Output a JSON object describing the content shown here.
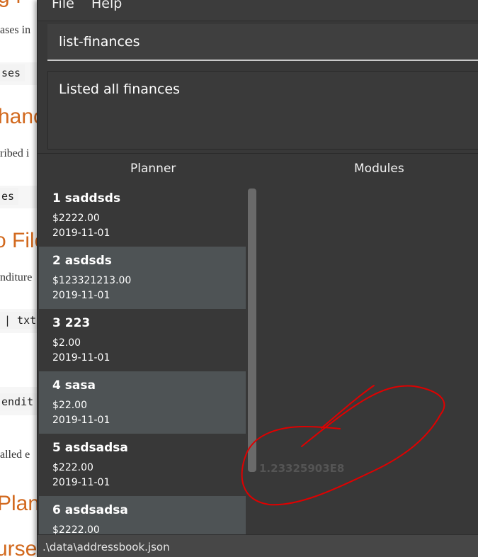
{
  "background_doc": {
    "fragments": [
      {
        "text": "g f",
        "style": "h"
      },
      {
        "text": "ases in",
        "style": "p"
      },
      {
        "text": "ses",
        "style": "code"
      },
      {
        "text": "hanc",
        "style": "h"
      },
      {
        "text": "ribed i",
        "style": "p"
      },
      {
        "text": "es",
        "style": "code"
      },
      {
        "text": "o File",
        "style": "h"
      },
      {
        "text": "nditure",
        "style": "p"
      },
      {
        "text": "| txt",
        "style": "code"
      },
      {
        "text": "endit",
        "style": "code"
      },
      {
        "text": "alled e",
        "style": "p"
      },
      {
        "text": "Plan",
        "style": "h"
      },
      {
        "text": "urse",
        "style": "h"
      }
    ]
  },
  "menu": {
    "file": "File",
    "help": "Help"
  },
  "command": {
    "value": "list-finances"
  },
  "result": {
    "text": "Listed all finances"
  },
  "tabs": {
    "planner": "Planner",
    "modules": "Modules"
  },
  "finances": [
    {
      "title": "1  saddsds",
      "amount": "$2222.00",
      "date": "2019-11-01"
    },
    {
      "title": "2  asdsds",
      "amount": "$123321213.00",
      "date": "2019-11-01"
    },
    {
      "title": "3  223",
      "amount": "$2.00",
      "date": "2019-11-01"
    },
    {
      "title": "4  sasa",
      "amount": "$22.00",
      "date": "2019-11-01"
    },
    {
      "title": "5  asdsadsa",
      "amount": "$222.00",
      "date": "2019-11-01"
    },
    {
      "title": "6  asdsadsa",
      "amount": "$2222.00",
      "date": ""
    }
  ],
  "overflow_value": "1.23325903E8",
  "status": {
    "path": ".\\data\\addressbook.json"
  },
  "colors": {
    "annotation": "#e00000",
    "accent_heading": "#d2691e",
    "card_alt": "#4e5355"
  }
}
